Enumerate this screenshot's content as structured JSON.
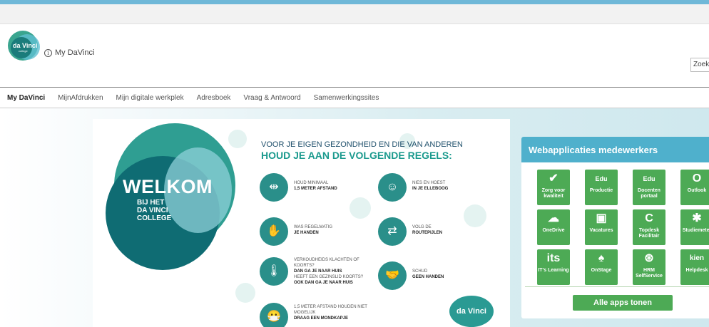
{
  "header": {
    "site_title": "My DaVinci",
    "logo_text": "da Vinci",
    "logo_subtext": "college",
    "search_placeholder": "Zoek"
  },
  "nav": {
    "items": [
      {
        "label": "My DaVinci",
        "active": true
      },
      {
        "label": "MijnAfdrukken"
      },
      {
        "label": "Mijn digitale werkplek"
      },
      {
        "label": "Adresboek"
      },
      {
        "label": "Vraag & Antwoord"
      },
      {
        "label": "Samenwerkingssites"
      }
    ]
  },
  "banner": {
    "welkom": "WELKOM",
    "welkom_sub": [
      "BIJ HET",
      "DA VINCI",
      "COLLEGE"
    ],
    "heading_line1": "VOOR JE EIGEN GEZONDHEID EN DIE VAN ANDEREN",
    "heading_line2": "HOUD JE AAN DE VOLGENDE REGELS:",
    "rules": [
      {
        "line": "HOUD MINIMAAL",
        "bold": "1,5 METER AFSTAND",
        "icon": "distance-icon"
      },
      {
        "line": "NIES EN HOEST",
        "bold": "IN JE ELLEBOOG",
        "icon": "sneeze-icon"
      },
      {
        "line": "WAS REGELMATIG",
        "bold": "JE HANDEN",
        "icon": "handwash-icon"
      },
      {
        "line": "VOLG DE",
        "bold": "ROUTEPIJLEN",
        "icon": "arrows-icon"
      },
      {
        "line": "VERKOUDHEIDS KLACHTEN OF KOORTS?",
        "bold": "DAN GA JE NAAR HUIS",
        "line2": "HEEFT EEN GEZINSLID KOORTS?",
        "bold2": "OOK DAN GA JE NAAR HUIS",
        "icon": "thermometer-icon"
      },
      {
        "line": "SCHUD",
        "bold": "GEEN HANDEN",
        "icon": "handshake-icon"
      },
      {
        "line": "1,5 METER AFSTAND HOUDEN NIET MOGELIJK",
        "bold": "DRAAG EEN MONDKAPJE",
        "icon": "mask-icon"
      }
    ],
    "logo_text": "da Vinci"
  },
  "apps": {
    "title": "Webapplicaties medewerkers",
    "tiles": [
      {
        "label": "Zorg voor kwaliteit",
        "icon": "checkmark-icon",
        "glyph": "✔"
      },
      {
        "label": "Productie",
        "icon": "eduarte-icon",
        "glyph": "Edu"
      },
      {
        "label": "Docenten portaal",
        "icon": "eduarte-icon",
        "glyph": "Edu"
      },
      {
        "label": "Outlook",
        "icon": "outlook-icon",
        "glyph": "O"
      },
      {
        "label": "OneDrive",
        "icon": "cloud-icon",
        "glyph": "☁"
      },
      {
        "label": "Vacatures",
        "icon": "briefcase-icon",
        "glyph": "▣"
      },
      {
        "label": "Topdesk Facilitair",
        "icon": "topdesk-icon",
        "glyph": "C"
      },
      {
        "label": "Studiemeter",
        "icon": "studiemeter-icon",
        "glyph": "✱"
      },
      {
        "label": "IT's Learning",
        "icon": "itslearning-icon",
        "glyph": "its"
      },
      {
        "label": "OnStage",
        "icon": "onstage-icon",
        "glyph": "♠"
      },
      {
        "label": "HRM SelfService",
        "icon": "hrm-icon",
        "glyph": "⊛"
      },
      {
        "label": "Helpdesk",
        "icon": "kien-icon",
        "glyph": "kien"
      }
    ],
    "button_label": "Alle apps tonen"
  }
}
